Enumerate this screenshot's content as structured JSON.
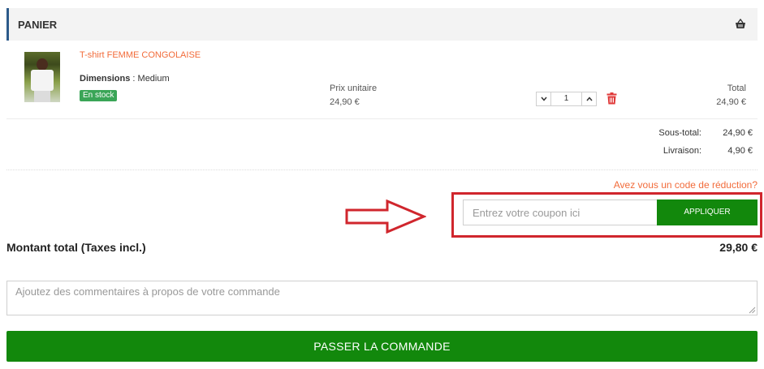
{
  "header": {
    "title": "PANIER",
    "icon": "basket-icon"
  },
  "product": {
    "name": "T-shirt FEMME CONGOLAISE",
    "dimensions_label": "Dimensions",
    "dimensions_value": " : Medium",
    "stock": "En stock",
    "unit_price_label": "Prix unitaire",
    "unit_price": "24,90 €",
    "quantity": "1",
    "total_label": "Total",
    "total": "24,90 €"
  },
  "summary": {
    "subtotal_label": "Sous-total:",
    "subtotal_value": "24,90 €",
    "shipping_label": "Livraison:",
    "shipping_value": "4,90 €"
  },
  "promo": {
    "link": "Avez vous un code de réduction?",
    "placeholder": "Entrez votre coupon ici",
    "apply_label": "APPLIQUER"
  },
  "grand_total": {
    "label": "Montant total (Taxes incl.)",
    "value": "29,80 €"
  },
  "comments": {
    "placeholder": "Ajoutez des commentaires à propos de votre commande"
  },
  "checkout": {
    "label": "PASSER LA COMMANDE"
  },
  "colors": {
    "accent_green": "#12880c",
    "highlight_red": "#d0262d",
    "link_orange": "#f26b3a",
    "stock_green": "#3aa557"
  }
}
